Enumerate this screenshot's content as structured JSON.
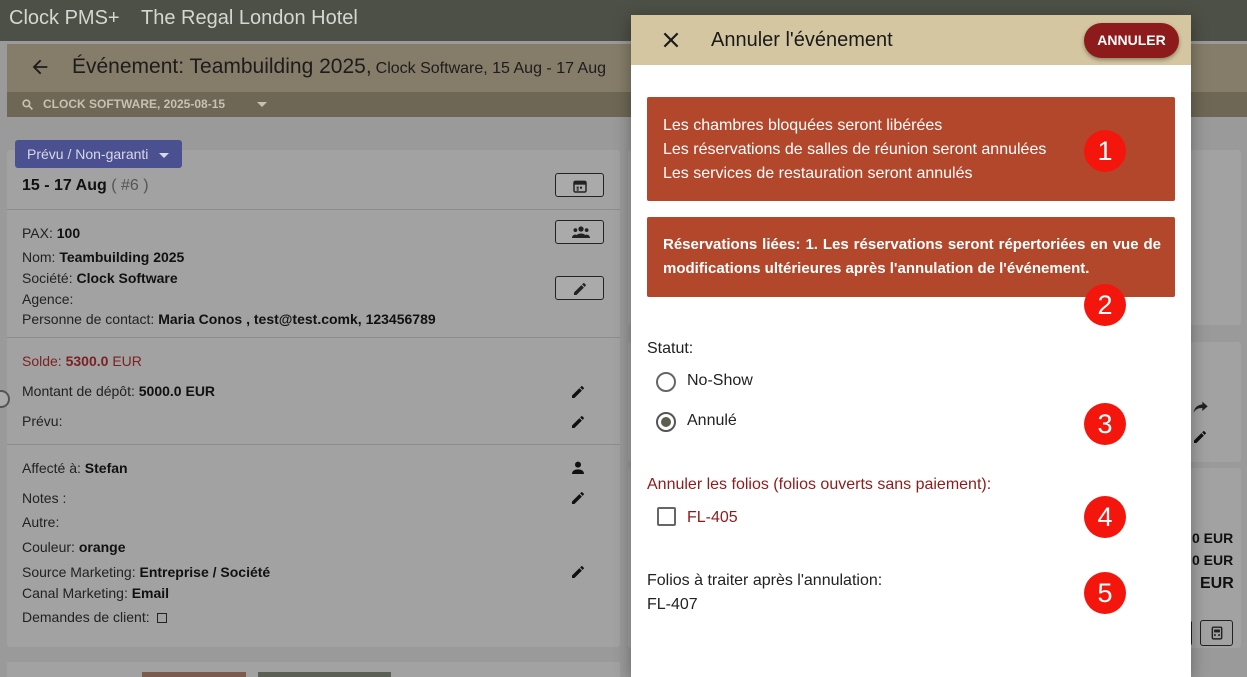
{
  "app": {
    "name": "Clock PMS+",
    "hotel": "The Regal London Hotel"
  },
  "event_bar": {
    "title": "Événement: Teambuilding 2025,",
    "subtitle": "Clock Software, 15 Aug - 17 Aug",
    "filter": "CLOCK SOFTWARE, 2025-08-15"
  },
  "booking": {
    "status": "Prévu / Non-garanti",
    "dates": "15 - 17 Aug",
    "number": "( #6 )",
    "pax_label": "PAX:",
    "pax": "100",
    "name_label": "Nom:",
    "name": "Teambuilding 2025",
    "company_label": "Société:",
    "company": "Clock Software",
    "agency_label": "Agence:",
    "contact_label": "Personne de contact:",
    "contact": "Maria Conos , test@test.comk, 123456789",
    "balance_label": "Solde:",
    "balance": "5300.0",
    "balance_cur": "EUR",
    "deposit_label": "Montant de dépôt:",
    "deposit": "5000.0 EUR",
    "planned_label": "Prévu:",
    "assigned_label": "Affecté à:",
    "assigned": "Stefan",
    "notes_label": "Notes :",
    "other_label": "Autre:",
    "color_label": "Couleur:",
    "color": "orange",
    "source_label": "Source Marketing:",
    "source": "Entreprise / Société",
    "channel_label": "Canal Marketing:",
    "channel": "Email",
    "requests_label": "Demandes de client:"
  },
  "right_panel": {
    "amount1": "0 EUR",
    "amount2": "0 EUR",
    "amount3": "EUR"
  },
  "dialog": {
    "title": "Annuler l'événement",
    "action": "ANNULER",
    "alert_lines": [
      "Les chambres bloquées seront libérées",
      "Les réservations de salles de réunion seront annulées",
      "Les services de restauration seront annulés"
    ],
    "linked_note": "Réservations liées: 1. Les réservations seront répertoriées en vue de modifications ultérieures après l'annulation de l'événement.",
    "status_label": "Statut:",
    "status_options": [
      "No-Show",
      "Annulé"
    ],
    "status_selected": "Annulé",
    "folios_label": "Annuler les folios (folios ouverts sans paiement):",
    "folio_option": "FL-405",
    "after_label": "Folios à traiter après l'annulation:",
    "after_value": "FL-407"
  },
  "badges": [
    "1",
    "2",
    "3",
    "4",
    "5"
  ],
  "colors": {
    "header": "#d4c6a0",
    "alert": "#b2472c",
    "action": "#8e1b1b",
    "badge": "#f4160d"
  }
}
